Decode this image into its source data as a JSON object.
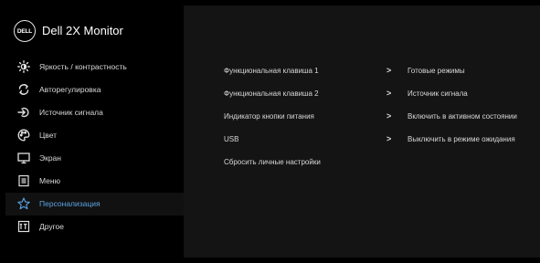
{
  "header": {
    "logo_text": "DELL",
    "model": "Dell 2X Monitor"
  },
  "menu": [
    {
      "icon": "brightness-icon",
      "label": "Яркость / контрастность",
      "selected": false
    },
    {
      "icon": "auto-adjust-icon",
      "label": "Авторегулировка",
      "selected": false
    },
    {
      "icon": "input-source-icon",
      "label": "Источник сигнала",
      "selected": false
    },
    {
      "icon": "color-icon",
      "label": "Цвет",
      "selected": false
    },
    {
      "icon": "display-icon",
      "label": "Экран",
      "selected": false
    },
    {
      "icon": "menu-icon",
      "label": "Меню",
      "selected": false
    },
    {
      "icon": "personalize-star-icon",
      "label": "Персонализация",
      "selected": true
    },
    {
      "icon": "others-icon",
      "label": "Другое",
      "selected": false
    }
  ],
  "options": [
    {
      "label": "Функциональная клавиша 1",
      "value": "Готовые режимы"
    },
    {
      "label": "Функциональная клавиша 2",
      "value": "Источник сигнала"
    },
    {
      "label": "Индикатор кнопки питания",
      "value": "Включить в активном состоянии"
    },
    {
      "label": "USB",
      "value": "Выключить в режиме ожидания"
    },
    {
      "label": "Сбросить личные настройки",
      "value": ""
    }
  ],
  "colors": {
    "accent": "#5ba4e6",
    "background": "#000000",
    "panel": "#141414",
    "text": "#d8d8d8"
  }
}
